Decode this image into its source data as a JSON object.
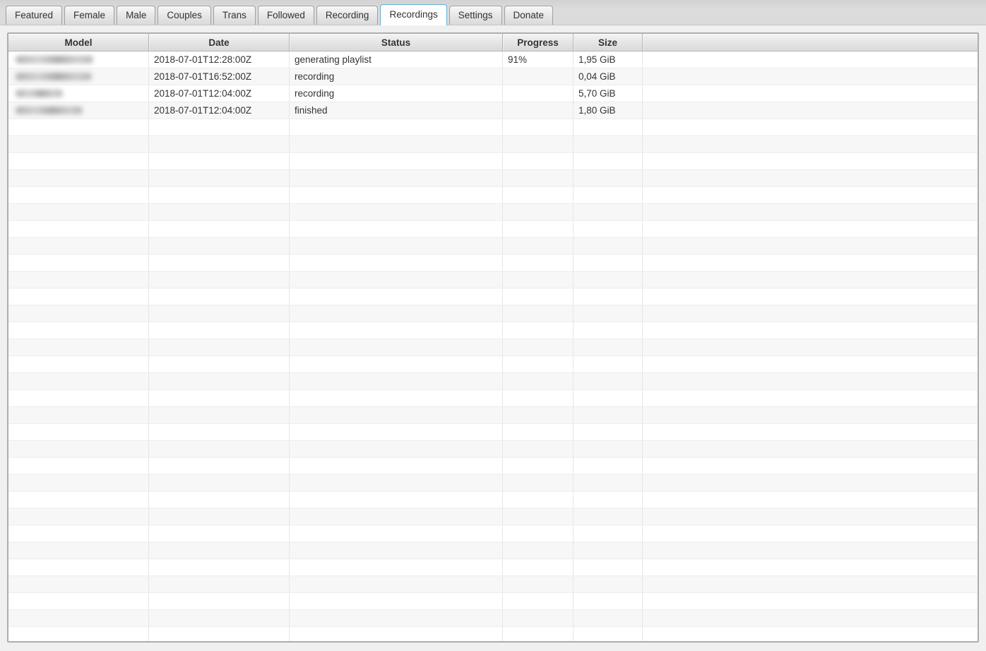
{
  "tabs": {
    "items": [
      {
        "label": "Featured",
        "active": false
      },
      {
        "label": "Female",
        "active": false
      },
      {
        "label": "Male",
        "active": false
      },
      {
        "label": "Couples",
        "active": false
      },
      {
        "label": "Trans",
        "active": false
      },
      {
        "label": "Followed",
        "active": false
      },
      {
        "label": "Recording",
        "active": false
      },
      {
        "label": "Recordings",
        "active": true
      },
      {
        "label": "Settings",
        "active": false
      },
      {
        "label": "Donate",
        "active": false
      }
    ]
  },
  "colors": {
    "active_tab_border": "#5fb0d8",
    "window_background": "#f0f0f0",
    "row_alternate": "#f7f7f7",
    "header_text": "#333333"
  },
  "table": {
    "columns": [
      {
        "label": "Model"
      },
      {
        "label": "Date"
      },
      {
        "label": "Status"
      },
      {
        "label": "Progress"
      },
      {
        "label": "Size"
      },
      {
        "label": ""
      }
    ],
    "rows": [
      {
        "model_redacted": true,
        "date": "2018-07-01T12:28:00Z",
        "status": "generating playlist",
        "progress": "91%",
        "size": "1,95 GiB"
      },
      {
        "model_redacted": true,
        "date": "2018-07-01T16:52:00Z",
        "status": "recording",
        "progress": "",
        "size": "0,04 GiB"
      },
      {
        "model_redacted": true,
        "date": "2018-07-01T12:04:00Z",
        "status": "recording",
        "progress": "",
        "size": "5,70 GiB"
      },
      {
        "model_redacted": true,
        "date": "2018-07-01T12:04:00Z",
        "status": "finished",
        "progress": "",
        "size": "1,80 GiB"
      }
    ],
    "empty_row_count": 31
  }
}
